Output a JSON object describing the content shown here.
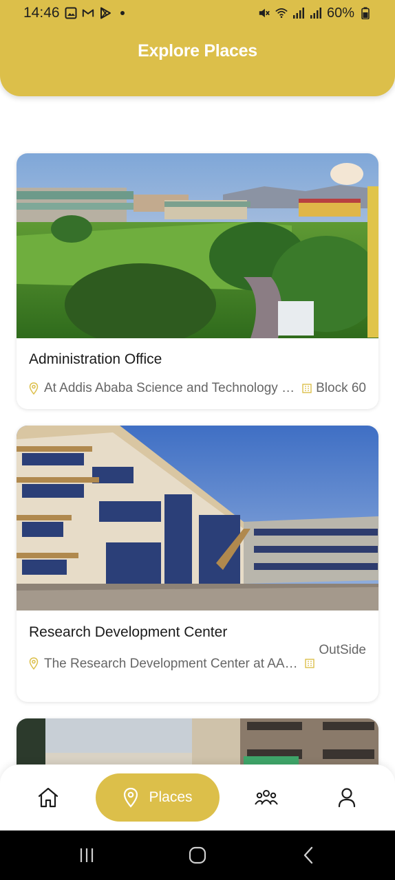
{
  "status_bar": {
    "time": "14:46",
    "battery": "60%",
    "icons": [
      "gallery-icon",
      "gmail-icon",
      "play-store-icon",
      "notification-dot",
      "mute-icon",
      "wifi-icon",
      "signal-icon",
      "signal-icon",
      "battery-icon"
    ]
  },
  "header": {
    "title": "Explore Places",
    "color": "#dcbf4a"
  },
  "places": [
    {
      "title": "Administration Office",
      "address": "At Addis Ababa Science and Technology University",
      "location": "Block 60"
    },
    {
      "title": "Research Development Center",
      "address": "The Research Development Center at AASTU",
      "location": "OutSide"
    }
  ],
  "bottom_nav": {
    "items": [
      {
        "name": "home",
        "icon": "home-icon"
      },
      {
        "name": "places",
        "icon": "location-pin-icon",
        "label": "Places",
        "active": true
      },
      {
        "name": "community",
        "icon": "group-icon"
      },
      {
        "name": "profile",
        "icon": "user-icon"
      }
    ]
  }
}
